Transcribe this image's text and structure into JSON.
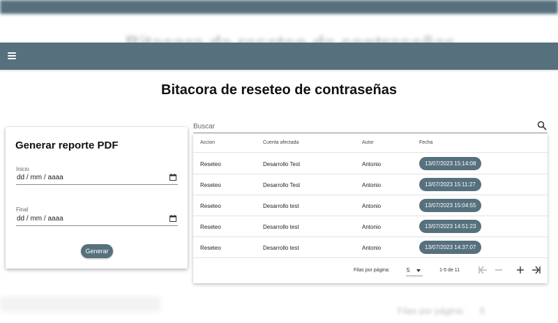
{
  "page": {
    "title": "Bitacora de reseteo de contraseñas"
  },
  "report": {
    "title": "Generar reporte PDF",
    "start_label": "Inicio",
    "start_value": "dd / mm / aaaa",
    "end_label": "Final",
    "end_value": "dd / mm / aaaa",
    "generate_label": "Generar"
  },
  "search": {
    "placeholder": "Buscar"
  },
  "table": {
    "headers": [
      "Accion",
      "Cuenta afectada",
      "Autor",
      "Fecha"
    ],
    "rows": [
      {
        "accion": "Reseteo",
        "cuenta": "Desarrollo Test",
        "autor": "Antonio",
        "fecha": "13/07/2023 15:14:08"
      },
      {
        "accion": "Reseteo",
        "cuenta": "Desarrollo Test",
        "autor": "Antonio",
        "fecha": "13/07/2023 15:11:27"
      },
      {
        "accion": "Reseteo",
        "cuenta": "Desarrollo test",
        "autor": "Antonio",
        "fecha": "13/07/2023 15:04:55"
      },
      {
        "accion": "Reseteo",
        "cuenta": "Desarrollo test",
        "autor": "Antonio",
        "fecha": "13/07/2023 14:51:23"
      },
      {
        "accion": "Reseteo",
        "cuenta": "Desarrollo test",
        "autor": "Antonio",
        "fecha": "13/07/2023 14:37:07"
      }
    ]
  },
  "pagination": {
    "rows_per_page_label": "Filas por página:",
    "rows_per_page_value": "5",
    "range_label": "1-5 de 11"
  },
  "icons": {
    "menu": "menu-icon",
    "calendar": "calendar-icon",
    "search": "search-icon",
    "first_page": "first-page-icon",
    "prev_page": "previous-page-icon",
    "next_page": "next-page-icon",
    "last_page": "last-page-icon"
  },
  "colors": {
    "primary": "#56707e",
    "background": "#ffffff",
    "text": "#222222"
  }
}
